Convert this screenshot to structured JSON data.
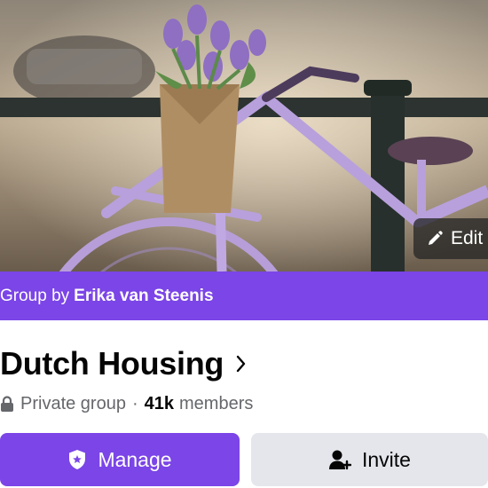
{
  "cover": {
    "image_description_icon": "bicycle-with-tulips-photo",
    "edit_label": "Edit"
  },
  "group_by": {
    "prefix": "Group by",
    "owner": "Erika van Steenis"
  },
  "group": {
    "title": "Dutch Housing",
    "privacy": "Private group",
    "separator": "·",
    "member_count": "41k",
    "members_label": "members"
  },
  "actions": {
    "manage_label": "Manage",
    "invite_label": "Invite"
  },
  "colors": {
    "accent": "#7b45e7",
    "secondary_button": "#e4e6eb",
    "text_primary": "#050505",
    "text_secondary": "#65676b"
  }
}
